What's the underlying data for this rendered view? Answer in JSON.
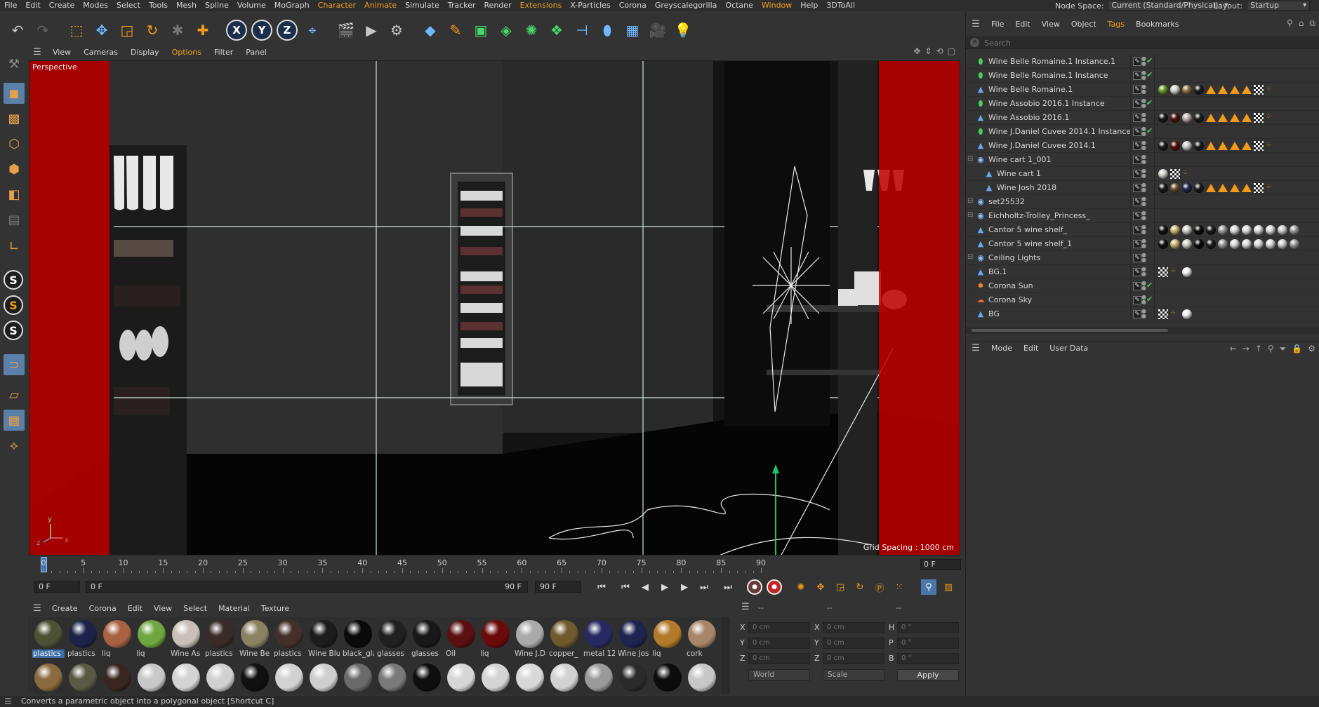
{
  "menubar": {
    "items": [
      "File",
      "Edit",
      "Create",
      "Modes",
      "Select",
      "Tools",
      "Mesh",
      "Spline",
      "Volume",
      "MoGraph",
      "Character",
      "Animate",
      "Simulate",
      "Tracker",
      "Render",
      "Extensions",
      "X-Particles",
      "Corona",
      "Greyscalegorilla",
      "Octane",
      "Window",
      "Help",
      "3DToAll"
    ],
    "highlighted": [
      "Character",
      "Animate",
      "Extensions",
      "Window"
    ],
    "node_space_label": "Node Space:",
    "node_space_value": "Current (Standard/Physical)",
    "layout_label": "Layout:",
    "layout_value": "Startup"
  },
  "toolbar": {
    "icons": [
      "undo-icon",
      "redo-icon",
      "live-selection-icon",
      "move-icon",
      "scale-icon",
      "rotate-icon",
      "recent-tool-icon",
      "add-icon",
      "x-axis-icon",
      "y-axis-icon",
      "z-axis-icon",
      "world-coordinates-icon",
      "render-region-icon",
      "render-view-icon",
      "render-settings-icon",
      "cube-icon",
      "pen-icon",
      "subdivision-icon",
      "extrude-icon",
      "cloner-icon",
      "mograph-icon",
      "deformer-icon",
      "spline-mask-icon",
      "floor-icon",
      "camera-icon",
      "light-icon"
    ],
    "axis_labels": [
      "X",
      "Y",
      "Z"
    ]
  },
  "left_tools": {
    "icons": [
      "make-editable-icon",
      "model-mode-icon",
      "texture-mode-icon",
      "points-mode-icon",
      "edges-mode-icon",
      "polygons-mode-icon",
      "uv-mode-icon",
      "axis-mode-icon",
      "s-snap-icon",
      "s-snap-2-icon",
      "s-snap-3-icon",
      "magnet-icon",
      "workplane-icon",
      "grid-icon",
      "quantize-icon"
    ],
    "s_labels": [
      "S",
      "S",
      "S"
    ]
  },
  "viewport": {
    "menu": [
      "View",
      "Cameras",
      "Display",
      "Options",
      "Filter",
      "Panel"
    ],
    "highlighted": [
      "Options"
    ],
    "label": "Perspective",
    "grid_spacing": "Grid Spacing : 1000 cm",
    "axis_labels": {
      "y": "y",
      "z": "z",
      "x": "x"
    }
  },
  "timeline": {
    "ticks": [
      "0",
      "5",
      "10",
      "15",
      "20",
      "25",
      "30",
      "35",
      "40",
      "45",
      "50",
      "55",
      "60",
      "65",
      "70",
      "75",
      "80",
      "85",
      "90"
    ],
    "current_frame": "0 F",
    "start_field": "0 F",
    "min_field": "0 F",
    "max_label": "90 F",
    "end_field": "90 F"
  },
  "material_manager": {
    "menu": [
      "Create",
      "Corona",
      "Edit",
      "View",
      "Select",
      "Material",
      "Texture"
    ],
    "row1": [
      {
        "label": "plastics",
        "color": "#4e5234",
        "selected": true
      },
      {
        "label": "plastics",
        "color": "#1d2348"
      },
      {
        "label": "liq",
        "color": "#a86242"
      },
      {
        "label": "liq",
        "color": "#6fa640"
      },
      {
        "label": "Wine As",
        "color": "#c8c0b8"
      },
      {
        "label": "plastics",
        "color": "#3a2b28"
      },
      {
        "label": "Wine Be",
        "color": "#8a8262"
      },
      {
        "label": "plastics",
        "color": "#44302a"
      },
      {
        "label": "Wine Blu",
        "color": "#1c1c1c"
      },
      {
        "label": "black_gla",
        "color": "#0a0a0a"
      },
      {
        "label": "glasses",
        "color": "#202020"
      },
      {
        "label": "glasses",
        "color": "#181818"
      },
      {
        "label": "Oil",
        "color": "#5a1010"
      },
      {
        "label": "liq",
        "color": "#6a0a0a"
      },
      {
        "label": "Wine J.D",
        "color": "#aaaaaa"
      },
      {
        "label": "copper_",
        "color": "#6e5a2e"
      },
      {
        "label": "metal 12",
        "color": "#262a60"
      },
      {
        "label": "Wine Jos",
        "color": "#1d2450"
      },
      {
        "label": "liq",
        "color": "#b27a2a"
      },
      {
        "label": "cork",
        "color": "#a8866a"
      }
    ],
    "row2_colors": [
      "#8a6a3e",
      "#5a5a44",
      "#3a2620",
      "#c8c8c8",
      "#d4d4d4",
      "#d0d0d0",
      "#101010",
      "#d2d2d2",
      "#cecece",
      "#6a6a6a",
      "#7a7a7a",
      "#0e0e0e",
      "#d6d6d6",
      "#d4d4d4",
      "#d8d8d8",
      "#d2d2d2",
      "#9a9a9a",
      "#2a2a2a",
      "#0c0c0c",
      "#c8c8c8"
    ]
  },
  "coordinates": {
    "headers": [
      "--",
      "--",
      "--"
    ],
    "rows": [
      {
        "a": "X",
        "av": "0 cm",
        "b": "X",
        "bv": "0 cm",
        "c": "H",
        "cv": "0 °"
      },
      {
        "a": "Y",
        "av": "0 cm",
        "b": "Y",
        "bv": "0 cm",
        "c": "P",
        "cv": "0 °"
      },
      {
        "a": "Z",
        "av": "0 cm",
        "b": "Z",
        "bv": "0 cm",
        "c": "B",
        "cv": "0 °"
      }
    ],
    "world_select": "World",
    "scale_select": "Scale",
    "apply_label": "Apply"
  },
  "object_manager": {
    "menu": [
      "File",
      "Edit",
      "View",
      "Object",
      "Tags",
      "Bookmarks"
    ],
    "highlighted": [
      "Tags"
    ],
    "search_placeholder": "Search",
    "objects": [
      {
        "name": "Wine Belle Romaine.1 Instance.1",
        "icon": "instance-icon",
        "indent": 0,
        "check": true,
        "tags": []
      },
      {
        "name": "Wine Belle Romaine.1 Instance",
        "icon": "instance-icon",
        "indent": 0,
        "check": true,
        "tags": []
      },
      {
        "name": "Wine Belle Romaine.1",
        "icon": "bone-icon",
        "indent": 0,
        "check": false,
        "tags": [
          "ball:#6a9a30",
          "ball:#d0d0c8",
          "ball:#8a7040",
          "ball:#1a1a1a",
          "tri",
          "tri",
          "tri",
          "tri",
          "chk",
          "drop"
        ]
      },
      {
        "name": "Wine Assobio 2016.1 Instance",
        "icon": "instance-icon",
        "indent": 0,
        "check": true,
        "tags": []
      },
      {
        "name": "Wine Assobio 2016.1",
        "icon": "bone-icon",
        "indent": 0,
        "check": false,
        "tags": [
          "ball:#1a1a1a",
          "ball:#501010",
          "ball:#c0b0b0",
          "ball:#1a1a1a",
          "tri",
          "tri",
          "tri",
          "tri",
          "chk",
          "drop"
        ]
      },
      {
        "name": "Wine J.Daniel Cuvee 2014.1 Instance",
        "icon": "instance-icon",
        "indent": 0,
        "check": true,
        "tags": []
      },
      {
        "name": "Wine J.Daniel Cuvee 2014.1",
        "icon": "bone-icon",
        "indent": 0,
        "check": false,
        "tags": [
          "ball:#1a1a1a",
          "ball:#500e0e",
          "ball:#c8c8c8",
          "ball:#1a1a1a",
          "tri",
          "tri",
          "tri",
          "tri",
          "chk",
          "drop"
        ]
      },
      {
        "name": "Wine cart 1_001",
        "icon": "null-icon",
        "indent": 0,
        "check": false,
        "tags": []
      },
      {
        "name": "Wine cart 1",
        "icon": "bone-icon",
        "indent": 1,
        "check": false,
        "tags": [
          "ball:#d0d0c8",
          "chk",
          "drop"
        ]
      },
      {
        "name": "Wine Josh 2018",
        "icon": "bone-icon",
        "indent": 1,
        "check": false,
        "tags": [
          "ball:#1a1a1a",
          "ball:#6a5030",
          "ball:#1d2450",
          "ball:#1a1a1a",
          "tri",
          "tri",
          "tri",
          "tri",
          "chk",
          "drop"
        ]
      },
      {
        "name": "set25532",
        "icon": "null-icon",
        "indent": 0,
        "check": false,
        "tags": []
      },
      {
        "name": "Eichholtz-Trolley_Princess_",
        "icon": "null-icon",
        "indent": 0,
        "check": false,
        "tags": []
      },
      {
        "name": "Cantor 5 wine shelf_",
        "icon": "bone-icon",
        "indent": 0,
        "check": false,
        "tags": [
          "ball:#101010",
          "ball:#c8b070",
          "ball:#d0d0c8",
          "ball:#0a0a0a",
          "ball:#1a1a1a",
          "ball:#9a9a9a",
          "ball:#d8d8d8",
          "ball:#d8d8d8",
          "ball:#d8d8d8",
          "ball:#d8d8d8",
          "ball:#cccccc",
          "ball:#999999"
        ]
      },
      {
        "name": "Cantor 5 wine shelf_1",
        "icon": "bone-icon",
        "indent": 0,
        "check": false,
        "tags": [
          "ball:#101010",
          "ball:#c8b070",
          "ball:#d0d0c8",
          "ball:#0a0a0a",
          "ball:#1a1a1a",
          "ball:#9a9a9a",
          "ball:#d8d8d8",
          "ball:#d8d8d8",
          "ball:#d8d8d8",
          "ball:#d8d8d8",
          "ball:#cccccc",
          "ball:#999999"
        ]
      },
      {
        "name": "Ceiling Lights",
        "icon": "null-icon",
        "indent": 0,
        "check": false,
        "tags": []
      },
      {
        "name": "BG.1",
        "icon": "bone-icon",
        "indent": 0,
        "check": false,
        "tags": [
          "chk",
          "drop",
          "ball:#f0f0f0"
        ]
      },
      {
        "name": "Corona Sun",
        "icon": "sun-icon",
        "indent": 0,
        "check": true,
        "tags": []
      },
      {
        "name": "Corona Sky",
        "icon": "sky-icon",
        "indent": 0,
        "check": true,
        "tags": []
      },
      {
        "name": "BG",
        "icon": "bone-icon",
        "indent": 0,
        "check": false,
        "tags": [
          "chk",
          "drop",
          "ball:#f0f0f0"
        ]
      }
    ]
  },
  "attribute_manager": {
    "menu": [
      "Mode",
      "Edit",
      "User Data"
    ]
  },
  "status": {
    "text": "Converts a parametric object into a polygonal object [Shortcut C]"
  },
  "colors": {
    "accent_orange": "#f0a020",
    "selection_blue": "#3a6ea5",
    "viewport_red": "#c00000",
    "check_green": "#46d060"
  }
}
